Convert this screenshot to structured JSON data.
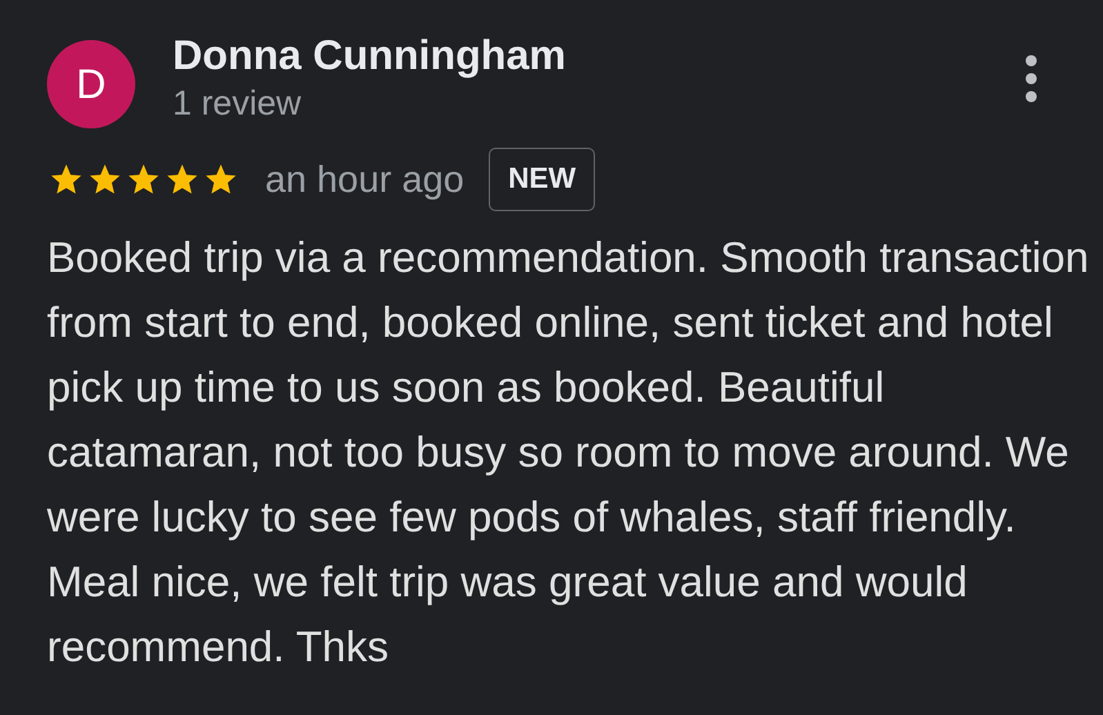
{
  "reviewer": {
    "initial": "D",
    "name": "Donna Cunningham",
    "meta": "1 review"
  },
  "review": {
    "stars": 5,
    "time": "an hour ago",
    "badge": "NEW",
    "text": "Booked trip via a recommendation. Smooth transaction from start to end, booked online, sent ticket and hotel pick up time to us soon as booked. Beautiful catamaran, not too busy so room to move around. We were lucky to see few pods of whales, staff friendly. Meal nice, we felt trip was great value and would recommend. Thks"
  }
}
